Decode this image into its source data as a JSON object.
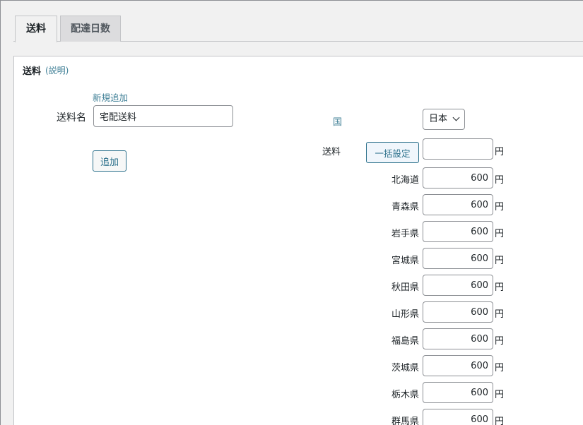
{
  "tabs": [
    {
      "label": "送料",
      "active": true
    },
    {
      "label": "配達日数",
      "active": false
    }
  ],
  "section": {
    "title": "送料",
    "help_link": "(説明)"
  },
  "left_form": {
    "new_add_link": "新規追加",
    "name_label": "送料名",
    "name_value": "宅配送料",
    "add_button": "追加"
  },
  "right_form": {
    "country_label": "国",
    "country_selected": "日本",
    "fee_label": "送料",
    "bulk_button": "一括設定",
    "bulk_value": "",
    "currency": "円",
    "prefectures": [
      {
        "name": "北海道",
        "fee": "600"
      },
      {
        "name": "青森県",
        "fee": "600"
      },
      {
        "name": "岩手県",
        "fee": "600"
      },
      {
        "name": "宮城県",
        "fee": "600"
      },
      {
        "name": "秋田県",
        "fee": "600"
      },
      {
        "name": "山形県",
        "fee": "600"
      },
      {
        "name": "福島県",
        "fee": "600"
      },
      {
        "name": "茨城県",
        "fee": "600"
      },
      {
        "name": "栃木県",
        "fee": "600"
      },
      {
        "name": "群馬県",
        "fee": "600"
      }
    ]
  },
  "colors": {
    "link": "#3f7f96",
    "panel_bg": "#ffffff",
    "page_bg": "#f1f1f1"
  }
}
